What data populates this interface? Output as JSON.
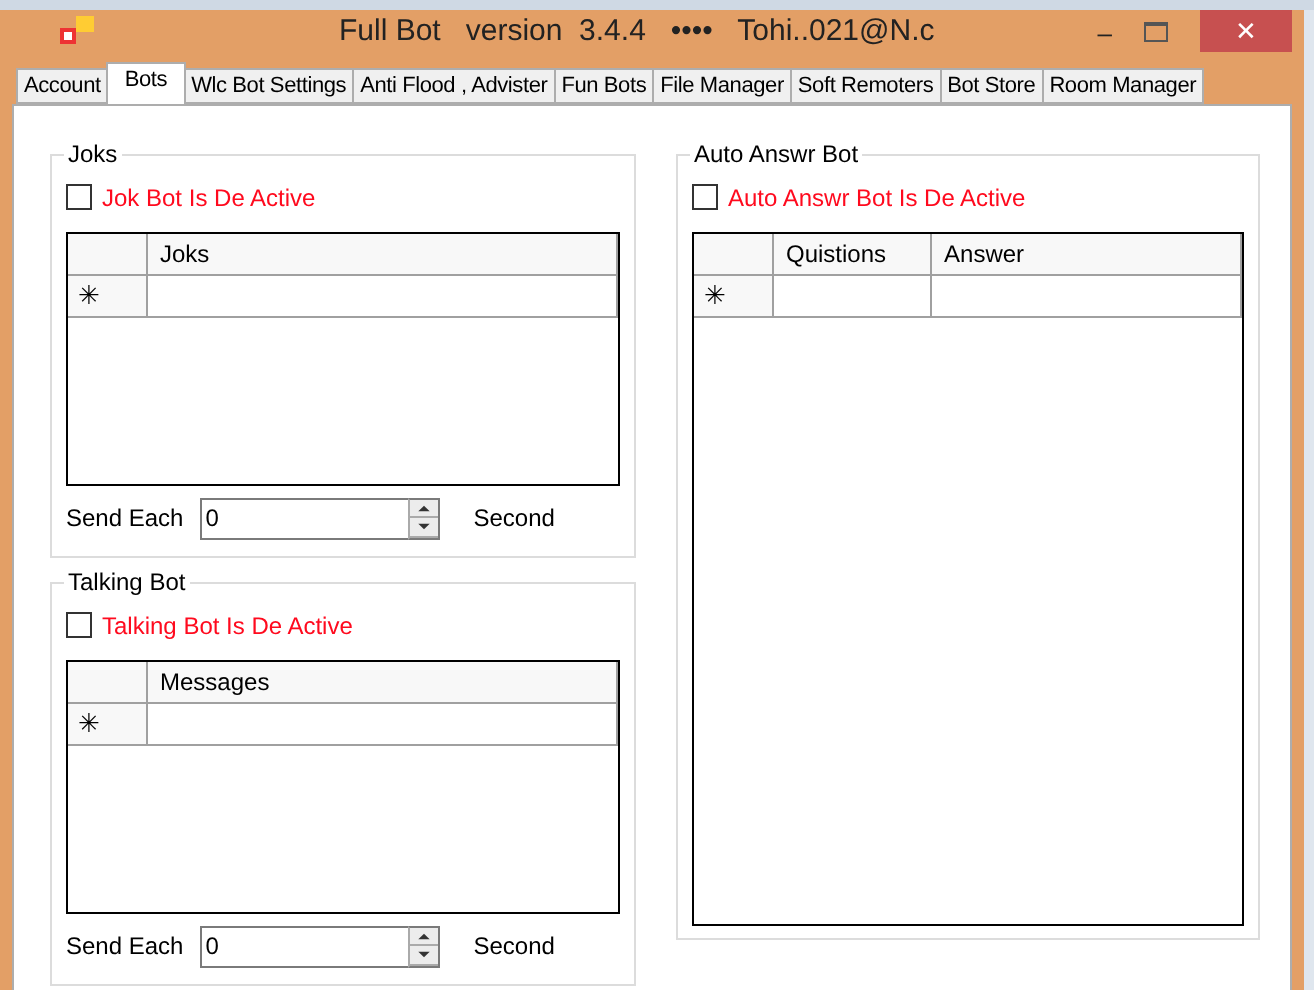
{
  "window": {
    "title": "Full Bot   version  3.4.4   ••••   Tohi..021@N.c",
    "minimize": "‒",
    "close": "✕"
  },
  "tabs": [
    {
      "label": "Account",
      "selected": false
    },
    {
      "label": "Bots",
      "selected": true
    },
    {
      "label": "Wlc Bot Settings",
      "selected": false
    },
    {
      "label": "Anti Flood , Advister",
      "selected": false
    },
    {
      "label": "Fun Bots",
      "selected": false
    },
    {
      "label": "File Manager",
      "selected": false
    },
    {
      "label": "Soft Remoters",
      "selected": false
    },
    {
      "label": "Bot Store",
      "selected": false
    },
    {
      "label": "Room Manager",
      "selected": false
    }
  ],
  "groups": [
    {
      "title": "Joks",
      "checkbox": {
        "label": "Jok Bot Is De Active",
        "checked": false
      },
      "grid": {
        "columns": [
          "Joks"
        ],
        "new_row_marker": "✳"
      },
      "send_each": {
        "label": "Send Each",
        "value": "0",
        "unit": "Second"
      }
    },
    {
      "title": "Talking Bot",
      "checkbox": {
        "label": "Talking Bot Is De Active",
        "checked": false
      },
      "grid": {
        "columns": [
          "Messages"
        ],
        "new_row_marker": "✳"
      },
      "send_each": {
        "label": "Send Each",
        "value": "0",
        "unit": "Second"
      }
    },
    {
      "title": "Auto Answr Bot",
      "checkbox": {
        "label": "Auto Answr Bot Is De Active",
        "checked": false
      },
      "grid": {
        "columns": [
          "Quistions",
          "Answer"
        ],
        "new_row_marker": "✳"
      }
    }
  ]
}
